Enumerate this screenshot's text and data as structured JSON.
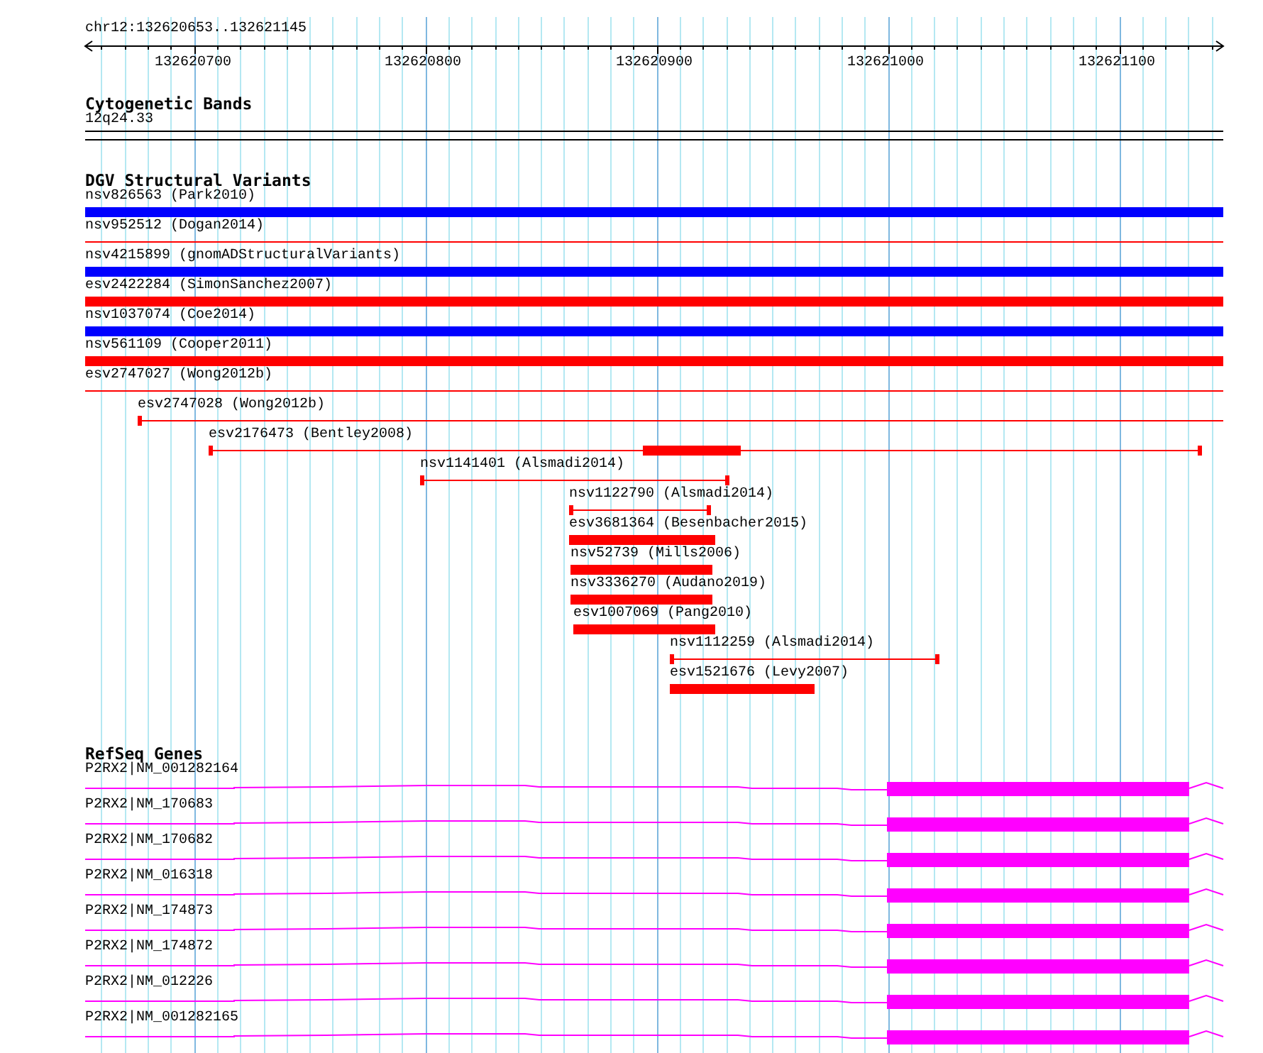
{
  "location": "chr12:132620653..132621145",
  "ruler": {
    "ticks": [
      "132620700",
      "132620800",
      "132620900",
      "132621000",
      "132621100"
    ]
  },
  "cytoband": {
    "title": "Cytogenetic Bands",
    "band": "12q24.33"
  },
  "variants": {
    "title": "DGV Structural Variants",
    "features": [
      {
        "label": "nsv826563 (Park2010)",
        "kind": "bar",
        "color": "#0000ff"
      },
      {
        "label": "nsv952512 (Dogan2014)",
        "kind": "line",
        "color": "#ff0000"
      },
      {
        "label": "nsv4215899 (gnomADStructuralVariants)",
        "kind": "bar",
        "color": "#0000ff"
      },
      {
        "label": "esv2422284 (SimonSanchez2007)",
        "kind": "bar",
        "color": "#ff0000"
      },
      {
        "label": "nsv1037074 (Coe2014)",
        "kind": "bar",
        "color": "#0000ff"
      },
      {
        "label": "nsv561109 (Cooper2011)",
        "kind": "bar",
        "color": "#ff0000"
      },
      {
        "label": "esv2747027 (Wong2012b)",
        "kind": "line",
        "color": "#ff0000"
      },
      {
        "label": "esv2747028 (Wong2012b)",
        "kind": "span",
        "color": "#ff0000"
      },
      {
        "label": "esv2176473 (Bentley2008)",
        "kind": "span-block",
        "color": "#ff0000"
      },
      {
        "label": "nsv1141401 (Alsmadi2014)",
        "kind": "span",
        "color": "#ff0000"
      },
      {
        "label": "nsv1122790 (Alsmadi2014)",
        "kind": "span",
        "color": "#ff0000"
      },
      {
        "label": "esv3681364 (Besenbacher2015)",
        "kind": "bar",
        "color": "#ff0000"
      },
      {
        "label": "nsv52739 (Mills2006)",
        "kind": "bar",
        "color": "#ff0000"
      },
      {
        "label": "nsv3336270 (Audano2019)",
        "kind": "bar",
        "color": "#ff0000"
      },
      {
        "label": "esv1007069 (Pang2010)",
        "kind": "bar",
        "color": "#ff0000"
      },
      {
        "label": "nsv1112259 (Alsmadi2014)",
        "kind": "span",
        "color": "#ff0000"
      },
      {
        "label": "esv1521676 (Levy2007)",
        "kind": "bar",
        "color": "#ff0000"
      }
    ]
  },
  "genes": {
    "title": "RefSeq Genes",
    "transcripts": [
      {
        "label": "P2RX2|NM_001282164"
      },
      {
        "label": "P2RX2|NM_170683"
      },
      {
        "label": "P2RX2|NM_170682"
      },
      {
        "label": "P2RX2|NM_016318"
      },
      {
        "label": "P2RX2|NM_174873"
      },
      {
        "label": "P2RX2|NM_174872"
      },
      {
        "label": "P2RX2|NM_012226"
      },
      {
        "label": "P2RX2|NM_001282165"
      }
    ]
  }
}
